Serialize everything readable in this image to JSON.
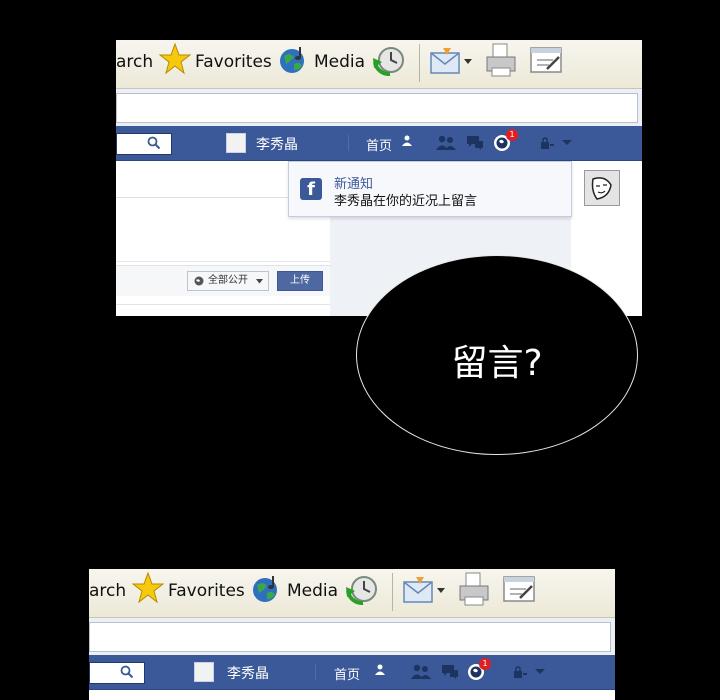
{
  "top_panel": {
    "toolbar": {
      "search_fragment": "arch",
      "favorites_label": "Favorites",
      "media_label": "Media"
    },
    "fb_bar": {
      "user_name": "李秀晶",
      "home_label": "首页",
      "notification_count": "1"
    },
    "notification": {
      "title": "新通知",
      "message": "李秀晶在你的近况上留言"
    },
    "composer": {
      "privacy_label": "全部公开",
      "upload_label": "上传"
    }
  },
  "speech_bubble": {
    "text": "留言?"
  },
  "bottom_panel": {
    "toolbar": {
      "search_fragment": "arch",
      "favorites_label": "Favorites",
      "media_label": "Media"
    },
    "fb_bar": {
      "user_name": "李秀晶",
      "home_label": "首页",
      "notification_count": "1"
    }
  },
  "colors": {
    "facebook_blue": "#3b5998",
    "toolbar_bg": "#ece9d8",
    "badge_red": "#e02020"
  }
}
